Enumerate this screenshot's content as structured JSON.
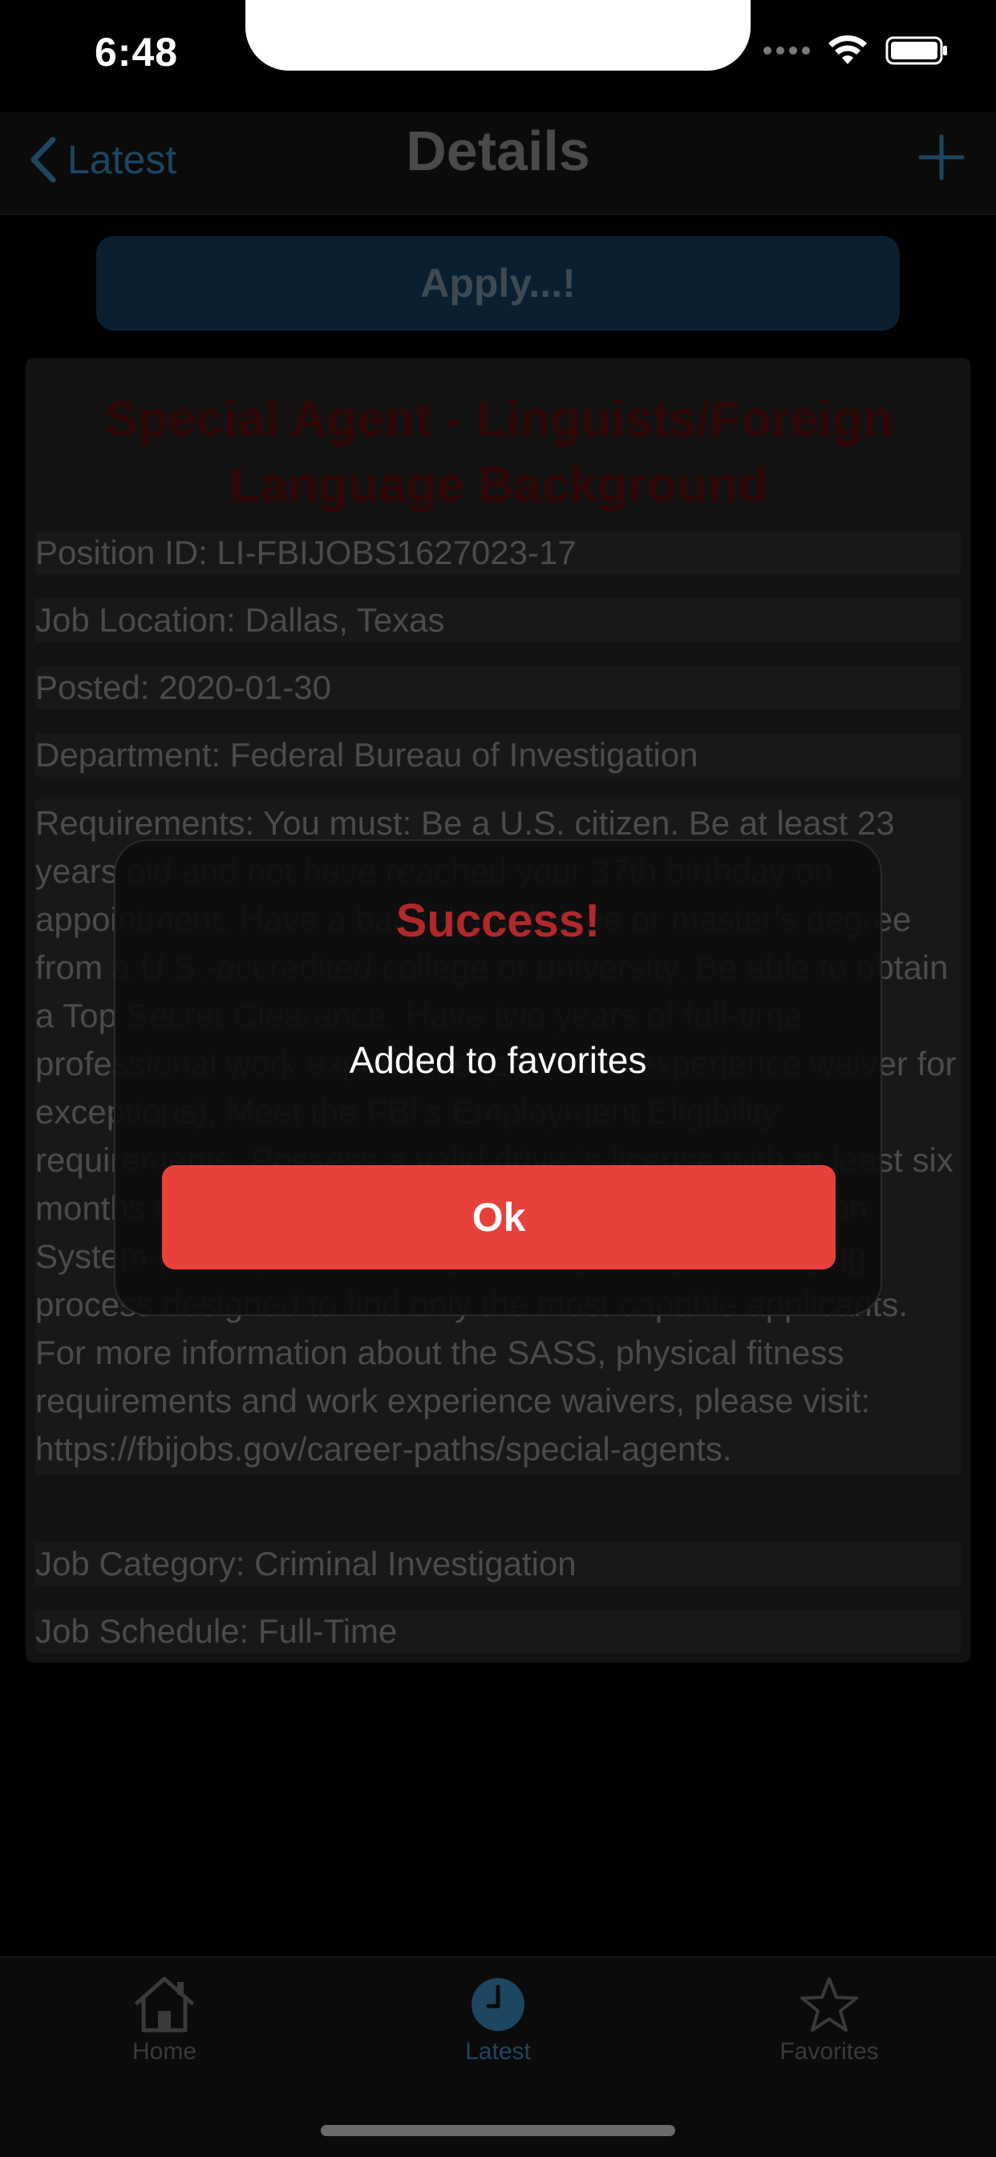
{
  "status_bar": {
    "time": "6:48"
  },
  "nav": {
    "back_label": "Latest",
    "title": "Details",
    "add_icon": "plus-icon",
    "back_icon": "chevron-left-icon"
  },
  "apply_button": {
    "label": "Apply...!"
  },
  "job": {
    "title": "Special Agent - Linguists/Foreign Language Background",
    "position_id": "Position ID: LI-FBIJOBS1627023-17",
    "location": "Job Location: Dallas, Texas",
    "posted": "Posted: 2020-01-30",
    "department": "Department: Federal Bureau of Investigation",
    "requirements": "Requirements: You must: Be a U.S. citizen. Be at least 23 years old and not have reached your 37th birthday on appointment. Have a bachelor's degree or master's degree from a U.S.-accredited college or university. Be able to obtain a Top Secret Clearance. Have two years of full-time professional work experience (see work experience waiver for exceptions). Meet the FBI's Employment Eligibility requirements. Possess a valid driver's license with at least six months driving experience. The Special Agent Selection System (SASS) is a mentally and physically challenging process designed to find only the most capable applicants. For more information about the SASS, physical fitness requirements and work experience waivers, please visit: https://fbijobs.gov/career-paths/special-agents.",
    "category": "Job Category: Criminal Investigation",
    "schedule": "Job Schedule: Full-Time"
  },
  "tabs": [
    {
      "label": "Home",
      "icon": "house-icon",
      "active": false
    },
    {
      "label": "Latest",
      "icon": "clock-icon",
      "active": true
    },
    {
      "label": "Favorites",
      "icon": "star-icon",
      "active": false
    }
  ],
  "alert": {
    "title": "Success!",
    "message": "Added to favorites",
    "ok_label": "Ok"
  },
  "colors": {
    "accent": "#1d4660",
    "alert_title": "#b0282b",
    "ok_button": "#e8403b",
    "job_title": "#2e0707"
  }
}
